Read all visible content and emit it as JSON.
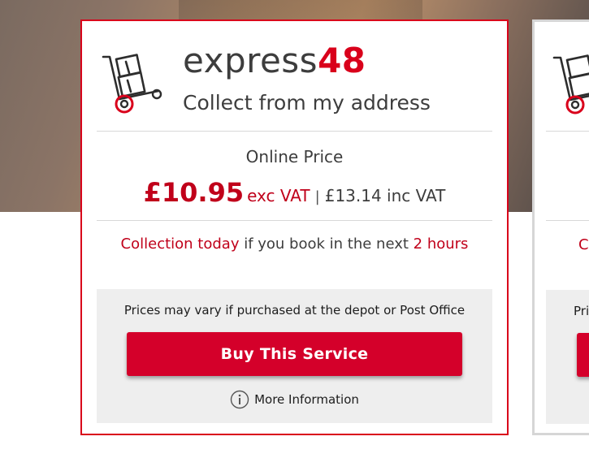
{
  "service": {
    "title_prefix": "express",
    "title_suffix": "48",
    "subtitle": "Collect from my address",
    "icon": "delivery-trolley-icon"
  },
  "pricing": {
    "label": "Online Price",
    "price_exc": "£10.95",
    "exc_label": "exc VAT",
    "separator": "|",
    "price_inc_text": "£13.14 inc VAT"
  },
  "collection": {
    "highlight_start": "Collection today",
    "middle": " if you book in the next ",
    "highlight_end": "2 hours"
  },
  "footer": {
    "notice": "Prices may vary if purchased at the depot or Post Office",
    "buy_label": "Buy This Service",
    "more_info_label": "More Information"
  },
  "next_card": {
    "collection_initial": "C",
    "notice_partial": "Pri"
  },
  "colors": {
    "accent_red": "#d9001b",
    "button_red": "#d4002a",
    "text_dark": "#3d3d3d",
    "footer_bg": "#eeeeee"
  }
}
